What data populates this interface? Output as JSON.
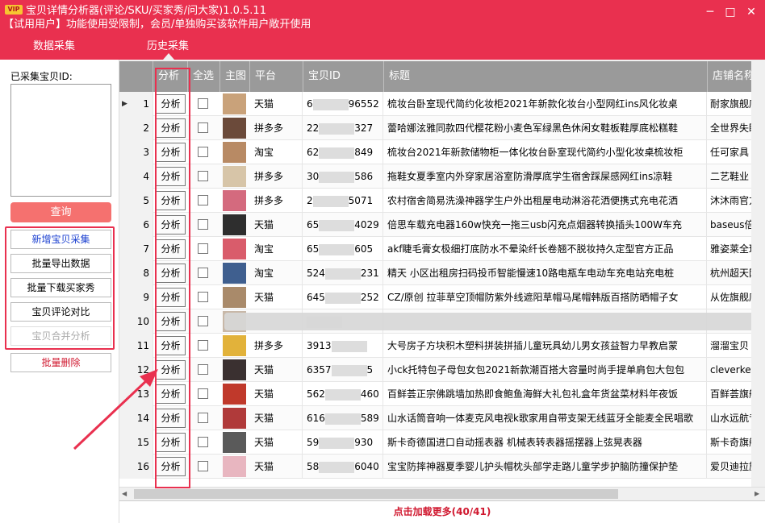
{
  "app": {
    "title": "宝贝详情分析器(评论/SKU/买家秀/问大家)1.0.5.11",
    "badge": "VIP",
    "trial_notice": "【试用用户】功能使用受限制，会员/单独购买该软件用户敞开使用"
  },
  "tabs": {
    "collect": "数据采集",
    "history": "历史采集"
  },
  "sidebar": {
    "collected_label": "已采集宝贝ID:",
    "query": "查询",
    "add": "新增宝贝采集",
    "export": "批量导出数据",
    "download_show": "批量下载买家秀",
    "compare": "宝贝评论对比",
    "merge": "宝贝合并分析",
    "delete": "批量删除"
  },
  "table": {
    "headers": [
      "分析",
      "全选",
      "主图",
      "平台",
      "宝贝ID",
      "标题",
      "店铺名称"
    ],
    "analyze_label": "分析",
    "rows": [
      {
        "n": "1",
        "platform": "天猫",
        "id": "6",
        "id2": "96552",
        "title": "梳妆台卧室现代简约化妆柜2021年新款化妆台小型网红ins风化妆桌",
        "shop": "耐家旗舰店",
        "color": "#c9a27a"
      },
      {
        "n": "2",
        "platform": "拼多多",
        "id": "22",
        "id2": "327",
        "title": "蕾哈娜泫雅同款四代樱花粉小麦色军绿黑色休闲女鞋板鞋厚底松糕鞋",
        "shop": "全世界失眠",
        "color": "#6b4a3a"
      },
      {
        "n": "3",
        "platform": "淘宝",
        "id": "62",
        "id2": "849",
        "title": "梳妆台2021年新款储物柜一体化妆台卧室现代简约小型化妆桌梳妆柜",
        "shop": "任可家具",
        "color": "#b88a64"
      },
      {
        "n": "4",
        "platform": "拼多多",
        "id": "30",
        "id2": "586",
        "title": "拖鞋女夏季室内外穿家居浴室防滑厚底学生宿舍踩屎感网红ins凉鞋",
        "shop": "二艺鞋业",
        "color": "#d7c5a8"
      },
      {
        "n": "5",
        "platform": "拼多多",
        "id": "2",
        "id2": "5071",
        "title": "农村宿舍简易洗澡神器学生户外出租屋电动淋浴花洒便携式充电花洒",
        "shop": "沐沐雨官方",
        "color": "#d46a7e"
      },
      {
        "n": "6",
        "platform": "天猫",
        "id": "65",
        "id2": "4029",
        "title": "倍思车载充电器160w快充一拖三usb闪充点烟器转换插头100W车充",
        "shop": "baseus倍思",
        "color": "#2e2e2e"
      },
      {
        "n": "7",
        "platform": "淘宝",
        "id": "65",
        "id2": "605",
        "title": "akf睫毛膏女极细打底防水不晕染纤长卷翘不脱妆持久定型官方正品",
        "shop": "雅姿莱全球",
        "color": "#d95c6b"
      },
      {
        "n": "8",
        "platform": "淘宝",
        "id": "524",
        "id2": "231",
        "title": "精天 小区出租房扫码投币智能慢速10路电瓶车电动车充电站充电桩",
        "shop": "杭州超天网",
        "color": "#3f5f8f"
      },
      {
        "n": "9",
        "platform": "天猫",
        "id": "645",
        "id2": "252",
        "title": "CZ/原创 拉菲草空顶帽防紫外线遮阳草帽马尾帽韩版百搭防晒帽子女",
        "shop": "从佐旗舰店",
        "color": "#a98a6a"
      },
      {
        "n": "10",
        "platform": "",
        "id": "",
        "id2": "",
        "title": "",
        "shop": "",
        "color": "#c8b8a8"
      },
      {
        "n": "11",
        "platform": "拼多多",
        "id": "3913",
        "id2": "",
        "title": "大号房子方块积木塑料拼装拼插儿童玩具幼儿男女孩益智力早教启蒙",
        "shop": "溜溜宝贝",
        "color": "#e2b23a"
      },
      {
        "n": "12",
        "platform": "天猫",
        "id": "6357",
        "id2": "5",
        "title": "小ck托特包子母包女包2021新款潮百搭大容量时尚手提单肩包大包包",
        "shop": "cleverkett",
        "color": "#3a3030"
      },
      {
        "n": "13",
        "platform": "天猫",
        "id": "562",
        "id2": "460",
        "title": "百鲜荟正宗佛跳墙加热即食鲍鱼海鲜大礼包礼盒年货盆菜材料年夜饭",
        "shop": "百鲜荟旗舰",
        "color": "#c0392b"
      },
      {
        "n": "14",
        "platform": "天猫",
        "id": "616",
        "id2": "589",
        "title": "山水话筒音响一体麦克风电视k歌家用自带支架无线蓝牙全能麦全民唱歌",
        "shop": "山水远航专",
        "color": "#b03a3a"
      },
      {
        "n": "15",
        "platform": "天猫",
        "id": "59",
        "id2": "930",
        "title": "斯卡奇德国进口自动摇表器 机械表转表器摇摆器上弦晃表器",
        "shop": "斯卡奇旗舰",
        "color": "#5a5a5a"
      },
      {
        "n": "16",
        "platform": "天猫",
        "id": "58",
        "id2": "6040",
        "title": "宝宝防摔神器夏季婴儿护头帽枕头部学走路儿童学步护脑防撞保护垫",
        "shop": "爱贝迪拉旗",
        "color": "#e8b6c0"
      }
    ]
  },
  "footer": {
    "load_more": "点击加载更多(40/41)"
  },
  "colors": {
    "brand": "#e9304f",
    "header_gray": "#9a9a9a",
    "load_more": "#d0182f"
  }
}
